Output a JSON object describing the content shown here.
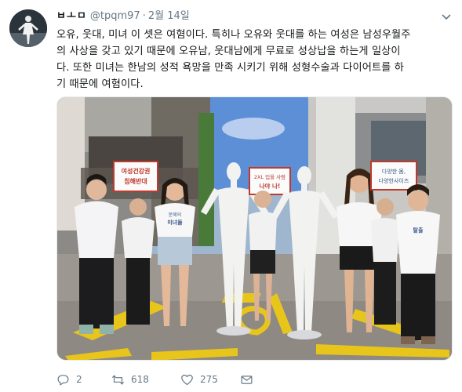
{
  "author": {
    "display_name": "ㅂㅗㅁ",
    "handle": "@tpqm97",
    "separator": "·",
    "date": "2월 14일"
  },
  "tweet": {
    "lines": [
      "오유, 웃대, 미녀 이 셋은 여혐이다. 특히나 오유와 웃대를 하는 여성은 남성우월주",
      "의 사상을 갖고 있기 때문에 오유남, 웃대남에게 무료로 성상납을 하는게 일상이",
      "다. 또한 미녀는 한남의 성적 욕망을 만족 시키기 위해 성형수술과 다이어트를 하",
      "기 때문에 여혐이다."
    ]
  },
  "photo": {
    "sign_left": [
      "여성건강권",
      "침해반대"
    ],
    "sign_center": [
      "2XL 입을 사람",
      "나야 나!"
    ],
    "sign_right": [
      "다양한 몸,",
      "다양한사이즈"
    ],
    "shirt_text": [
      "문제의",
      "미녀들",
      "탈출"
    ]
  },
  "actions": {
    "replies": "2",
    "retweets": "618",
    "likes": "275"
  },
  "icons": [
    "caret-down-icon",
    "reply-icon",
    "retweet-icon",
    "like-icon",
    "direct-message-icon"
  ],
  "colors": {
    "text": "#14171a",
    "secondary": "#657786",
    "sign_red": "#c0392b"
  }
}
